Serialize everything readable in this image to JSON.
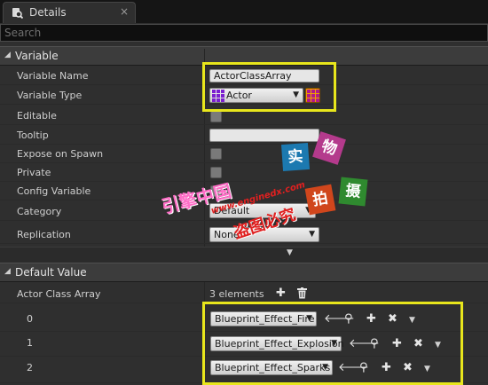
{
  "tab": {
    "icon": "magnifier-document-icon",
    "label": "Details",
    "close": "×"
  },
  "search": {
    "placeholder": "Search"
  },
  "variable_section": {
    "title": "Variable",
    "rows": {
      "variable_name": {
        "label": "Variable Name",
        "value": "ActorClassArray"
      },
      "variable_type": {
        "label": "Variable Type",
        "value": "Actor"
      },
      "editable": {
        "label": "Editable"
      },
      "tooltip": {
        "label": "Tooltip",
        "value": ""
      },
      "expose_on_spawn": {
        "label": "Expose on Spawn"
      },
      "private": {
        "label": "Private"
      },
      "config_variable": {
        "label": "Config Variable"
      },
      "category": {
        "label": "Category",
        "value": "Default"
      },
      "replication": {
        "label": "Replication",
        "value": "None"
      }
    }
  },
  "default_section": {
    "title": "Default Value",
    "array": {
      "label": "Actor Class Array",
      "count_text": "3 elements"
    },
    "elements": [
      {
        "index": "0",
        "value": "Blueprint_Effect_Fire"
      },
      {
        "index": "1",
        "value": "Blueprint_Effect_Explosion"
      },
      {
        "index": "2",
        "value": "Blueprint_Effect_Sparks"
      }
    ]
  },
  "colors": {
    "highlight": "#e8e61c",
    "actor_type": "#7b1fd0",
    "container": "#f0a000"
  },
  "watermark": {
    "cn_1": "引擎中国",
    "url": "www.enginedx.com",
    "cn_2": "盗图必究",
    "box_shi": "实",
    "box_wu": "物",
    "box_pai": "拍",
    "box_she": "摄"
  }
}
